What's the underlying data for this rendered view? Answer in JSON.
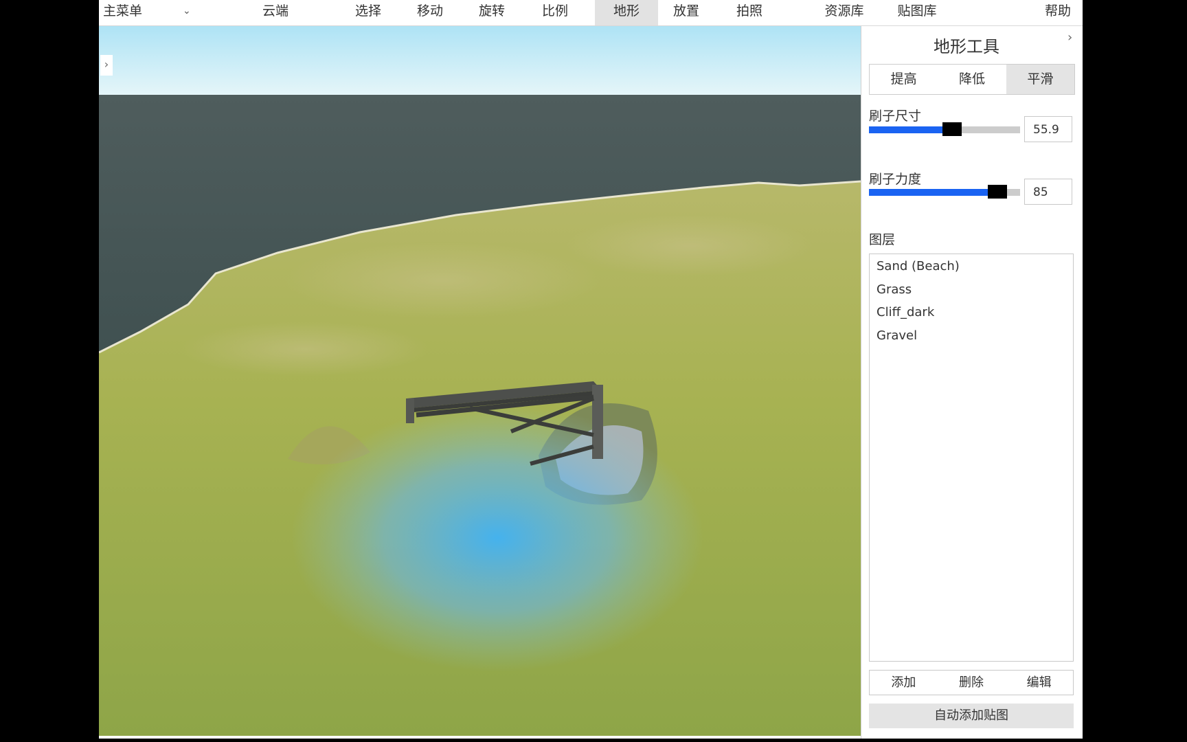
{
  "menubar": {
    "main_menu": "主菜单",
    "cloud": "云端",
    "select": "选择",
    "move": "移动",
    "rotate": "旋转",
    "scale": "比例",
    "terrain": "地形",
    "place": "放置",
    "photo": "拍照",
    "assets": "资源库",
    "textures": "贴图库",
    "help": "帮助",
    "active_item": "地形"
  },
  "panel": {
    "title": "地形工具",
    "tabs": [
      "提高",
      "降低",
      "平滑"
    ],
    "active_tab": "平滑",
    "brush_size": {
      "label": "刷子尺寸",
      "value": "55.9",
      "fraction": 0.55
    },
    "brush_strength": {
      "label": "刷子力度",
      "value": "85",
      "fraction": 0.85
    },
    "layers_label": "图层",
    "layers": [
      "Sand (Beach)",
      "Grass",
      "Cliff_dark",
      "Gravel"
    ],
    "layer_buttons": {
      "add": "添加",
      "delete": "删除",
      "edit": "编辑"
    },
    "auto_add": "自动添加贴图"
  },
  "colors": {
    "accent": "#1a63f2",
    "sky": "#cfeef8",
    "sea": "#4b5a5a",
    "grass": "#9fae4e",
    "brush": "#4fb8f0"
  },
  "icons": {
    "main_menu_dropdown": "chevron-down-icon",
    "collapse_left": "chevron-right-icon",
    "collapse_panel": "chevron-right-icon"
  }
}
